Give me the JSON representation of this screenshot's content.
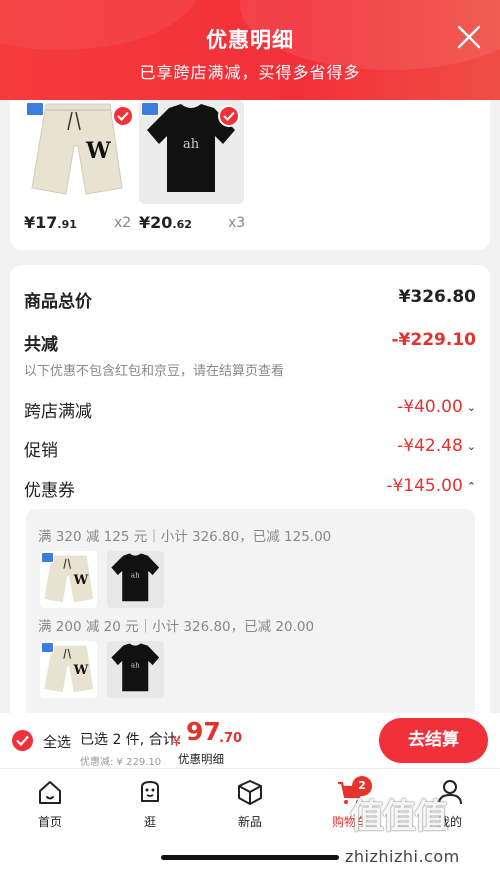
{
  "header": {
    "title": "优惠明细",
    "subtitle": "已享跨店满减，买得多省得多"
  },
  "products": [
    {
      "price_int": "¥17",
      "price_dec": ".91",
      "qty": "x2",
      "image": "beige-shorts"
    },
    {
      "price_int": "¥20",
      "price_dec": ".62",
      "qty": "x3",
      "image": "black-tshirt"
    }
  ],
  "summary": {
    "total_label": "商品总价",
    "total_value": "¥326.80",
    "reduced_label": "共减",
    "reduced_value": "-¥229.10",
    "note": "以下优惠不包含红包和京豆，请在结算页查看",
    "cross_store_label": "跨店满减",
    "cross_store_value": "-¥40.00",
    "promo_label": "促销",
    "promo_value": "-¥42.48",
    "coupon_label": "优惠券",
    "coupon_value": "-¥145.00",
    "chev_down": "⌄",
    "chev_up": "⌃"
  },
  "coupons": [
    {
      "text": "满 320 减 125 元｜小计 326.80，已减 125.00"
    },
    {
      "text": "满 200 减 20 元｜小计 326.80，已减 20.00"
    }
  ],
  "bottom_bar": {
    "select_all": "全选",
    "selected_text": "已选 2 件, 合计:",
    "currency": "¥",
    "total_int": "97",
    "total_dec": ".70",
    "discount": "优惠减: ¥ 229.10",
    "detail_link": "优惠明细",
    "checkout": "去结算"
  },
  "tabs": [
    {
      "label": "首页",
      "icon": "home-icon"
    },
    {
      "label": "逛",
      "icon": "browse-icon"
    },
    {
      "label": "新品",
      "icon": "box-icon"
    },
    {
      "label": "购物车",
      "icon": "cart-icon",
      "badge": "2"
    },
    {
      "label": "我的",
      "icon": "user-icon"
    }
  ],
  "watermark": {
    "logo": "值值值",
    "url": "zhizhizhi.com"
  },
  "colors": {
    "accent": "#f2303a",
    "price_red": "#e5322d"
  }
}
